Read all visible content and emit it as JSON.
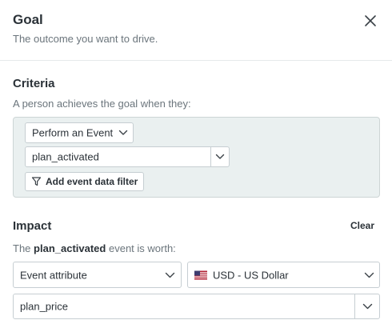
{
  "header": {
    "title": "Goal",
    "subtitle": "The outcome you want to drive."
  },
  "criteria": {
    "title": "Criteria",
    "helper": "A person achieves the goal when they:",
    "action_select": "Perform an Event",
    "event_value": "plan_activated",
    "add_filter_label": "Add event data filter"
  },
  "impact": {
    "title": "Impact",
    "clear_label": "Clear",
    "helper_prefix": "The",
    "helper_event": "plan_activated",
    "helper_suffix": "event is worth:",
    "value_type_select": "Event attribute",
    "currency_select": "USD - US Dollar",
    "attribute_value": "plan_price"
  },
  "icons": {
    "close": "close-icon",
    "chevron": "chevron-down-icon",
    "filter": "filter-icon",
    "flag": "us-flag-icon"
  },
  "colors": {
    "text": "#2b3238",
    "muted": "#6b757c",
    "panel_bg": "#eaf0f0",
    "border": "#c6ced2"
  }
}
